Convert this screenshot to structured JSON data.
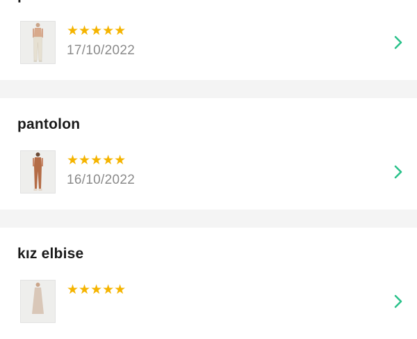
{
  "reviews": [
    {
      "title": "pantolon",
      "stars": "★★★★★",
      "rating": 5,
      "date": "17/10/2022",
      "thumb_icon": "beige-trousers-photo",
      "garment_color": "#e6e0d2"
    },
    {
      "title": "pantolon",
      "stars": "★★★★★",
      "rating": 5,
      "date": "16/10/2022",
      "thumb_icon": "brown-leggings-photo",
      "garment_color": "#b46c46"
    },
    {
      "title": "kız elbise",
      "stars": "★★★★★",
      "rating": 5,
      "date": "",
      "thumb_icon": "dress-photo",
      "garment_color": "#d9c7b8"
    }
  ],
  "colors": {
    "star": "#f5b400",
    "chevron": "#2bc28b",
    "separator": "#f4f4f4",
    "title": "#1a1a1a",
    "date": "#8a8a8a"
  }
}
